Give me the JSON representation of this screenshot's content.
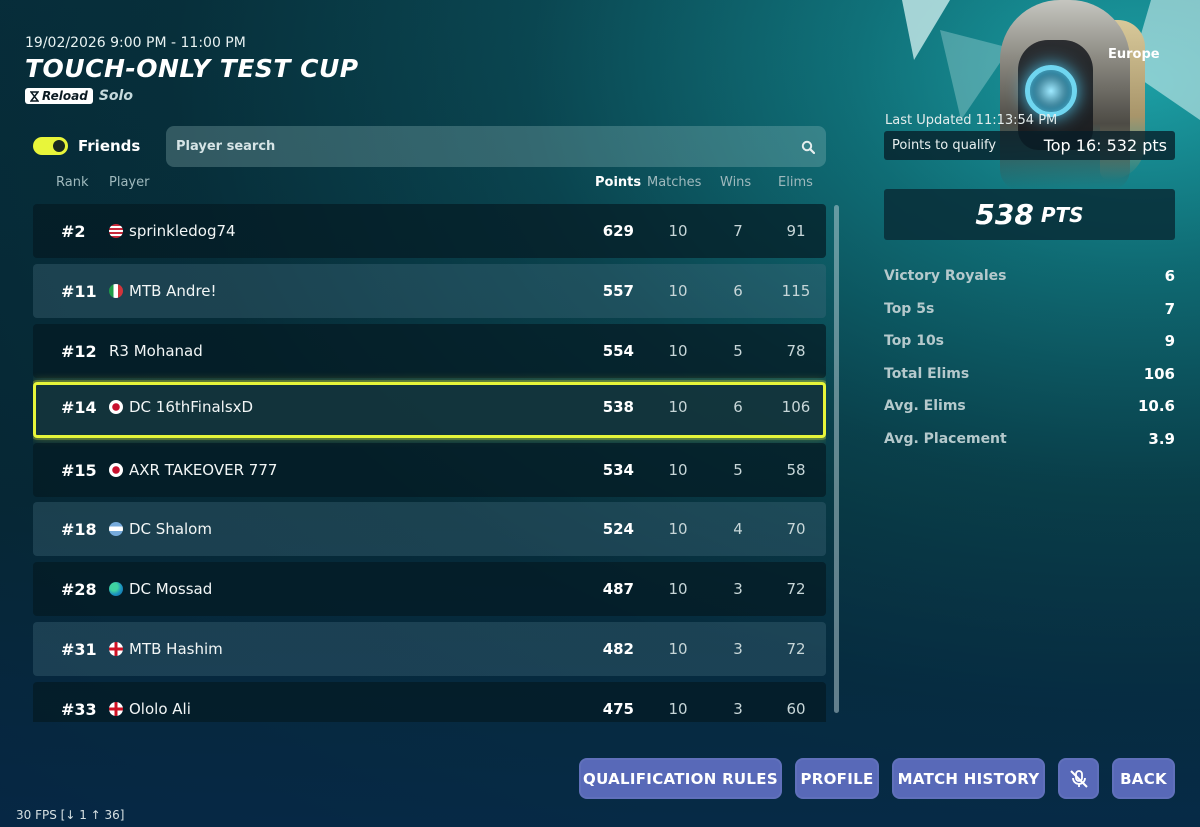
{
  "event": {
    "date": "19/02/2026 9:00 PM - 11:00 PM",
    "title": "TOUCH-ONLY TEST CUP",
    "badge": "Reload",
    "mode": "Solo",
    "region": "Europe"
  },
  "filters": {
    "friends_label": "Friends",
    "friends_on": true,
    "search_placeholder": "Player search"
  },
  "columns": {
    "rank": "Rank",
    "player": "Player",
    "points": "Points",
    "matches": "Matches",
    "wins": "Wins",
    "elims": "Elims"
  },
  "rows": [
    {
      "rank": "#2",
      "player": "sprinkledog74",
      "flag": "us",
      "points": "629",
      "matches": "10",
      "wins": "7",
      "elims": "91",
      "highlight": false
    },
    {
      "rank": "#11",
      "player": "MTB Andre!",
      "flag": "it",
      "points": "557",
      "matches": "10",
      "wins": "6",
      "elims": "115",
      "highlight": false
    },
    {
      "rank": "#12",
      "player": "R3 Mohanad",
      "flag": "",
      "points": "554",
      "matches": "10",
      "wins": "5",
      "elims": "78",
      "highlight": false
    },
    {
      "rank": "#14",
      "player": "DC 16thFinalsxD",
      "flag": "jp",
      "points": "538",
      "matches": "10",
      "wins": "6",
      "elims": "106",
      "highlight": true
    },
    {
      "rank": "#15",
      "player": "AXR TAKEOVER 777",
      "flag": "jp",
      "points": "534",
      "matches": "10",
      "wins": "5",
      "elims": "58",
      "highlight": false
    },
    {
      "rank": "#18",
      "player": "DC Shalom",
      "flag": "ar",
      "points": "524",
      "matches": "10",
      "wins": "4",
      "elims": "70",
      "highlight": false
    },
    {
      "rank": "#28",
      "player": "DC Mossad",
      "flag": "globe",
      "points": "487",
      "matches": "10",
      "wins": "3",
      "elims": "72",
      "highlight": false
    },
    {
      "rank": "#31",
      "player": "MTB Hashim",
      "flag": "gb-eng",
      "points": "482",
      "matches": "10",
      "wins": "3",
      "elims": "72",
      "highlight": false
    },
    {
      "rank": "#33",
      "player": "Ololo Ali",
      "flag": "gb-eng",
      "points": "475",
      "matches": "10",
      "wins": "3",
      "elims": "60",
      "highlight": false
    }
  ],
  "summary": {
    "last_updated": "Last Updated 11:13:54 PM",
    "qualify_label": "Points to qualify",
    "qualify_value": "Top 16: 532 pts",
    "points": "538",
    "points_unit": "PTS",
    "stats": [
      {
        "label": "Victory Royales",
        "value": "6"
      },
      {
        "label": "Top 5s",
        "value": "7"
      },
      {
        "label": "Top 10s",
        "value": "9"
      },
      {
        "label": "Total Elims",
        "value": "106"
      },
      {
        "label": "Avg. Elims",
        "value": "10.6"
      },
      {
        "label": "Avg. Placement",
        "value": "3.9"
      }
    ]
  },
  "buttons": {
    "qualification_rules": "QUALIFICATION RULES",
    "profile": "PROFILE",
    "match_history": "MATCH HISTORY",
    "back": "BACK"
  },
  "footer": {
    "fps": "30 FPS [↓ 1 ↑ 36]"
  },
  "colors": {
    "accent_yellow": "#e6f53a",
    "button_blue": "#5869b8"
  }
}
